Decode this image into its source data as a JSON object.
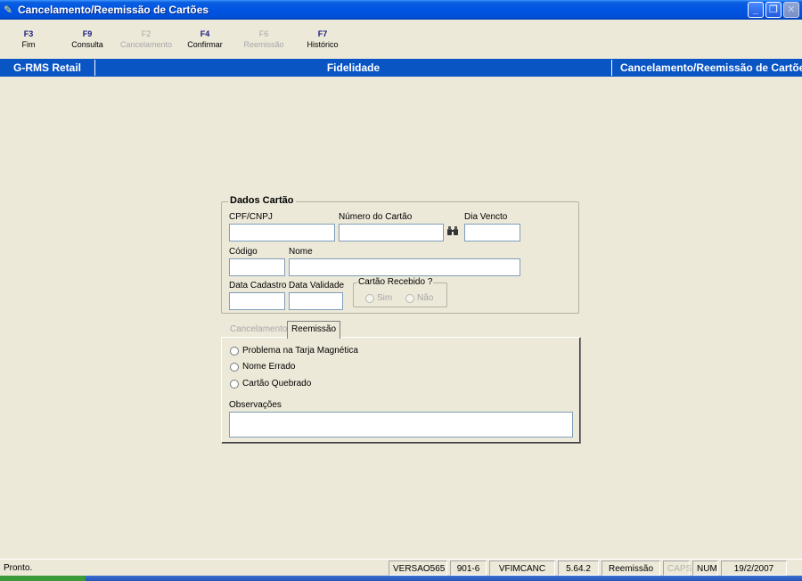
{
  "window": {
    "title": "Cancelamento/Reemissão de Cartões",
    "buttons": {
      "minimize": "_",
      "maximize": "❐",
      "close": "✕"
    }
  },
  "fkeys": [
    {
      "key": "F3",
      "label": "Fim",
      "enabled": true
    },
    {
      "key": "F9",
      "label": "Consulta",
      "enabled": true
    },
    {
      "key": "F2",
      "label": "Cancelamento",
      "enabled": false
    },
    {
      "key": "F4",
      "label": "Confirmar",
      "enabled": true
    },
    {
      "key": "F6",
      "label": "Reemissão",
      "enabled": false
    },
    {
      "key": "F7",
      "label": "Histórico",
      "enabled": true
    }
  ],
  "band": {
    "left": "G-RMS Retail",
    "center": "Fidelidade",
    "right": "Cancelamento/Reemissão de Cartões"
  },
  "dados_cartao": {
    "legend": "Dados Cartão",
    "cpf_label": "CPF/CNPJ",
    "cpf_value": "",
    "numero_label": "Número do Cartão",
    "numero_value": "",
    "dia_label": "Dia Vencto",
    "dia_value": "",
    "codigo_label": "Código",
    "codigo_value": "",
    "nome_label": "Nome",
    "nome_value": "",
    "data_cadastro_label": "Data Cadastro",
    "data_cadastro_value": "",
    "data_validade_label": "Data Validade",
    "data_validade_value": "",
    "recebido": {
      "legend": "Cartão Recebido ?",
      "sim": "Sim",
      "nao": "Não"
    }
  },
  "tabs": [
    {
      "label": "Cancelamento",
      "active": false
    },
    {
      "label": "Reemissão",
      "active": true
    }
  ],
  "reemissao": {
    "options": [
      "Problema na Tarja Magnética",
      "Nome Errado",
      "Cartão Quebrado"
    ],
    "observacoes_label": "Observações",
    "observacoes_value": ""
  },
  "status_bar": {
    "message": "Pronto.",
    "panes": [
      "VERSAO565",
      "901-6",
      "VFIMCANC",
      "5.64.2",
      "Reemissão",
      "CAPS",
      "NUM",
      "19/2/2007"
    ],
    "disabled_panes": [
      "CAPS"
    ]
  },
  "colors": {
    "titlebar": "#0054e3",
    "band": "#0a55c4",
    "face": "#ece9d8",
    "field_border": "#7f9db9",
    "fkey_text": "#1a1a80",
    "disabled_text": "#a7a6aa"
  },
  "icons": {
    "app": "key-icon",
    "search": "binoculars-icon"
  }
}
